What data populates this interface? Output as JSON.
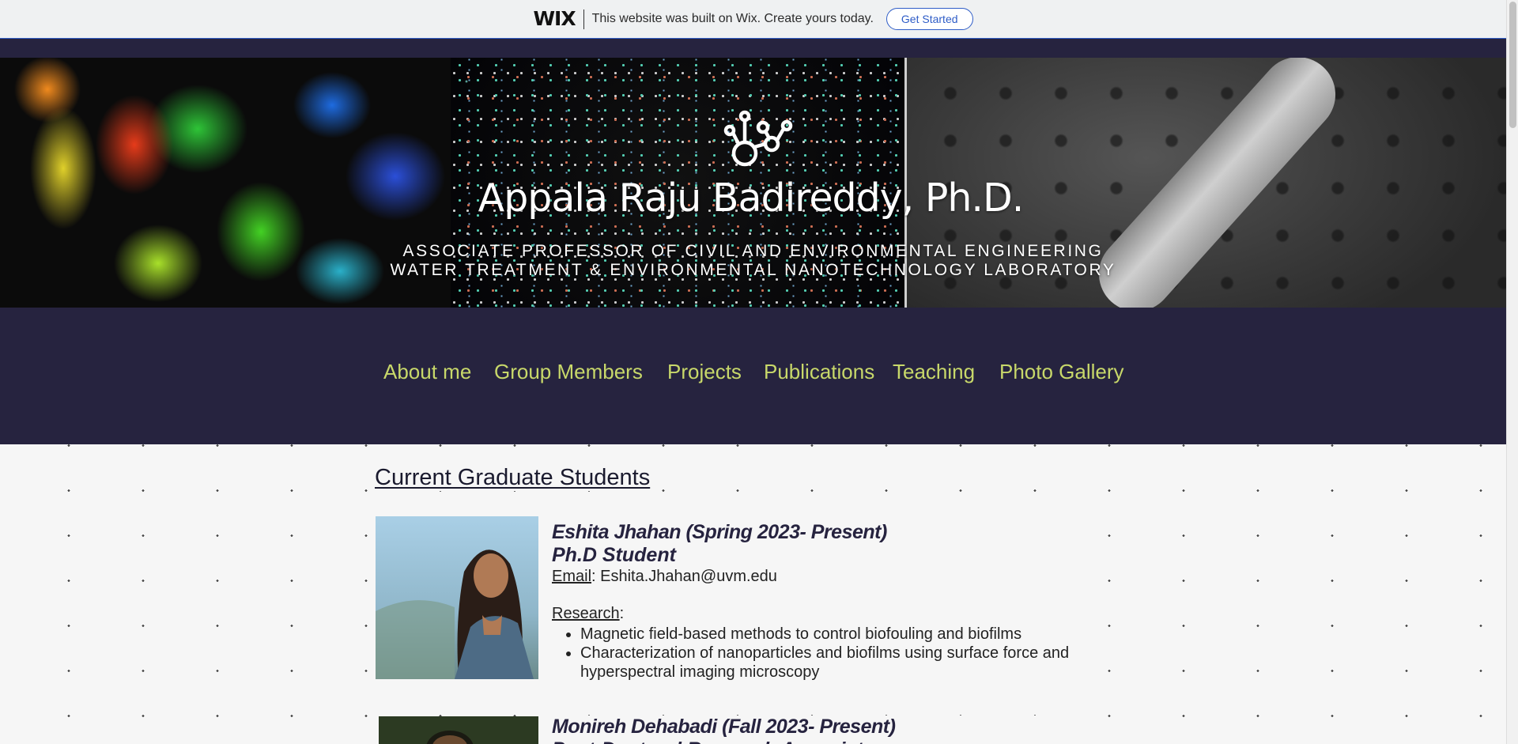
{
  "wix_banner": {
    "logo": "WIX",
    "message": "This website was built on Wix. Create yours today.",
    "button_label": "Get Started"
  },
  "header": {
    "title": "Appala Raju Badireddy, Ph.D.",
    "subtitle_line1": "ASSOCIATE PROFESSOR OF CIVIL AND ENVIRONMENTAL ENGINEERING",
    "subtitle_line2": "WATER TREATMENT & ENVIRONMENTAL NANOTECHNOLOGY LABORATORY",
    "logo_icon": "molecule-icon"
  },
  "nav": {
    "items": [
      "About me",
      "Group Members",
      "Projects",
      "Publications",
      "Teaching",
      "Photo Gallery"
    ],
    "color": "#c8d86a"
  },
  "main": {
    "section_title": "Current Graduate Students",
    "members": [
      {
        "name": "Eshita Jhahan (Spring 2023- Present)",
        "role": "Ph.D Student",
        "email_label": "Email",
        "email": "Eshita.Jhahan@uvm.edu",
        "research_label": "Research",
        "research": [
          "Magnetic field-based methods to control biofouling and biofilms",
          "Characterization of nanoparticles and biofilms using surface force and hyperspectral imaging microscopy"
        ]
      },
      {
        "name": "Monireh Dehabadi (Fall 2023- Present)",
        "role": "Post-Doctoral Research Associate"
      }
    ]
  },
  "colors": {
    "header_bg": "#26233f",
    "accent": "#2f5dc7",
    "name_color": "#26233f"
  }
}
